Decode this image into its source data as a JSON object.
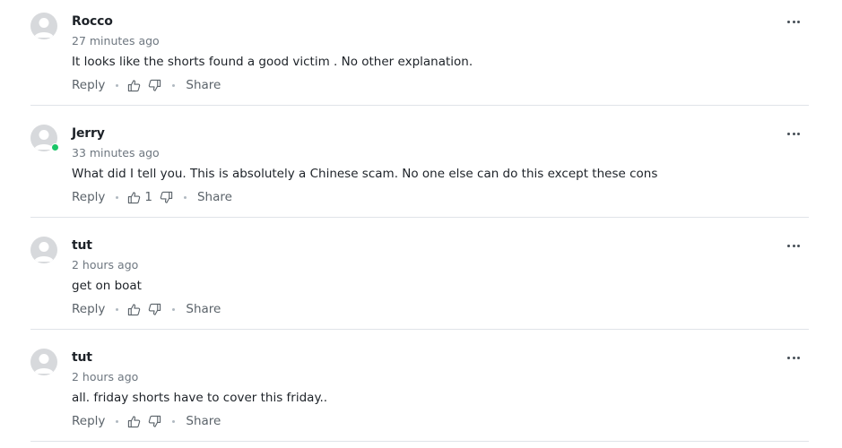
{
  "comments": [
    {
      "author": "Rocco",
      "time": "27 minutes ago",
      "text": "It looks like the shorts found a good victim . No other explanation.",
      "reply_label": "Reply",
      "share_label": "Share",
      "upvotes": "",
      "online": false
    },
    {
      "author": "Jerry",
      "time": "33 minutes ago",
      "text": "What did I tell you. This is absolutely a Chinese scam. No one else can do this except these cons",
      "reply_label": "Reply",
      "share_label": "Share",
      "upvotes": "1",
      "online": true
    },
    {
      "author": "tut",
      "time": "2 hours ago",
      "text": "get on boat",
      "reply_label": "Reply",
      "share_label": "Share",
      "upvotes": "",
      "online": false
    },
    {
      "author": "tut",
      "time": "2 hours ago",
      "text": "all. friday shorts have to cover this friday..",
      "reply_label": "Reply",
      "share_label": "Share",
      "upvotes": "",
      "online": false
    }
  ],
  "icons": {
    "avatar": "default-user-avatar-icon",
    "thumbs_up": "thumbs-up-icon",
    "thumbs_down": "thumbs-down-icon",
    "more": "more-horizontal-icon"
  },
  "colors": {
    "online_indicator": "#1ac567",
    "divider": "#e0e4e9",
    "secondary_text": "#6e7780"
  }
}
